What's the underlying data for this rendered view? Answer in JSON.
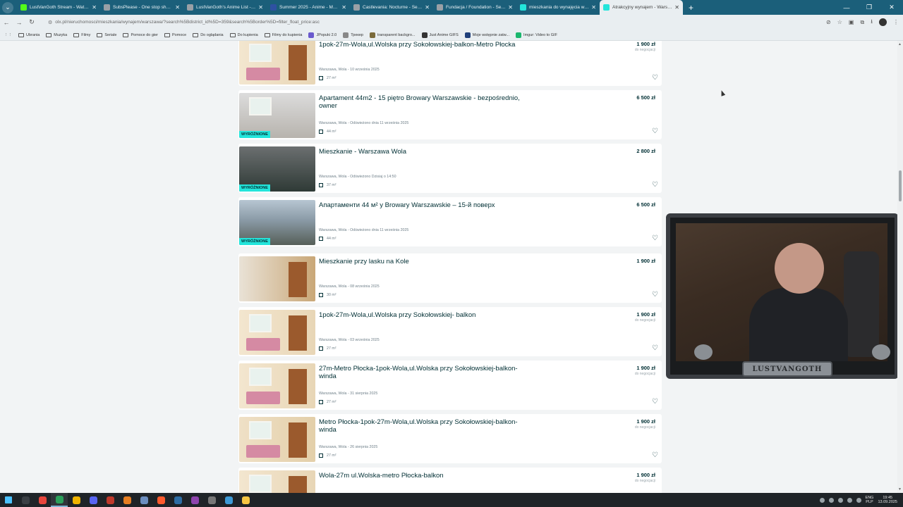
{
  "browser": {
    "tabs": [
      {
        "title": "LustVanGoth Stream - Watch Li",
        "color": "#53fc18"
      },
      {
        "title": "SubsPlease - One stop shop fo",
        "color": "#9aa0a6"
      },
      {
        "title": "LustVanGoth's Anime List - My",
        "color": "#9aa0a6"
      },
      {
        "title": "Summer 2025 - Anime - MyAni",
        "color": "#2e51a2"
      },
      {
        "title": "Castlevania: Nocturne - Sezon",
        "color": "#9aa0a6"
      },
      {
        "title": "Fundacja / Foundation - Sezon",
        "color": "#9aa0a6"
      },
      {
        "title": "mieszkania do wynajęcia warsz",
        "color": "#23e5db"
      },
      {
        "title": "Atrakcyjny wynajem - Warszaw",
        "color": "#23e5db",
        "active": true
      }
    ],
    "url": "olx.pl/nieruchomosci/mieszkania/wynajem/warszawa/?search%5Bdistrict_id%5D=359&search%5Border%5D=filter_float_price:asc",
    "bookmarks": [
      {
        "label": "Ubrania",
        "type": "folder"
      },
      {
        "label": "Muzyka",
        "type": "folder"
      },
      {
        "label": "Filmy",
        "type": "folder"
      },
      {
        "label": "Seriale",
        "type": "folder"
      },
      {
        "label": "Pomoce do gier",
        "type": "folder"
      },
      {
        "label": "Pomoce",
        "type": "folder"
      },
      {
        "label": "Do oglądania",
        "type": "folder"
      },
      {
        "label": "Do kupienia",
        "type": "folder"
      },
      {
        "label": "Filmy do kupienia",
        "type": "folder"
      },
      {
        "label": "JPopuki 2.0",
        "type": "site",
        "color": "#6a5acd"
      },
      {
        "label": "Трекер",
        "type": "site",
        "color": "#888"
      },
      {
        "label": "transparent backgro...",
        "type": "site",
        "color": "#7a6a3a"
      },
      {
        "label": "Just Anime GIFS",
        "type": "site",
        "color": "#333"
      },
      {
        "label": "Moje wstępnie zatw...",
        "type": "site",
        "color": "#1f3f7a"
      },
      {
        "label": "Imgur: Video to GIF",
        "type": "site",
        "color": "#1bb76e"
      }
    ]
  },
  "listings": [
    {
      "title": "1pok-27m-Wola,ul.Wolska przy Sokołowskiej-balkon-Metro Płocka",
      "location": "Warszawa, Wola - 10 września 2025",
      "area": "27 m²",
      "price": "1 900 zł",
      "negotiable": "do negocjacji",
      "featured": "",
      "photo": "room-pink"
    },
    {
      "title": "Apartament 44m2 - 15 piętro Browary Warszawskie - bezpośrednio, owner",
      "location": "Warszawa, Wola - Odświeżono dnia 11 września 2025",
      "area": "44 m²",
      "price": "6 500 zł",
      "negotiable": "",
      "featured": "WYRÓŻNIONE",
      "photo": "room-modern"
    },
    {
      "title": "Mieszkanie - Warszawa Wola",
      "location": "Warszawa, Wola - Odświeżono Dzisiaj o 14:50",
      "area": "37 m²",
      "price": "2 800 zł",
      "negotiable": "",
      "featured": "WYRÓŻNIONE",
      "photo": "room-dark"
    },
    {
      "title": "Апартаменти 44 м² у Browary Warszawskie – 15-й поверх",
      "location": "Warszawa, Wola - Odświeżono dnia 11 września 2025",
      "area": "44 m²",
      "price": "6 500 zł",
      "negotiable": "",
      "featured": "WYRÓŻNIONE",
      "photo": "city-view"
    },
    {
      "title": "Mieszkanie przy lasku na Kole",
      "location": "Warszawa, Wola - 08 września 2025",
      "area": "30 m²",
      "price": "1 900 zł",
      "negotiable": "",
      "featured": "",
      "photo": "room-wood"
    },
    {
      "title": "1pok-27m-Wola,ul.Wolska przy Sokołowskiej- balkon",
      "location": "Warszawa, Wola - 03 września 2025",
      "area": "27 m²",
      "price": "1 900 zł",
      "negotiable": "do negocjacji",
      "featured": "",
      "photo": "room-pink"
    },
    {
      "title": "27m-Metro Płocka-1pok-Wola,ul.Wolska przy Sokołowskiej-balkon-winda",
      "location": "Warszawa, Wola - 31 sierpnia 2025",
      "area": "27 m²",
      "price": "1 900 zł",
      "negotiable": "do negocjacji",
      "featured": "",
      "photo": "room-pink"
    },
    {
      "title": "Metro Płocka-1pok-27m-Wola,ul.Wolska przy Sokołowskiej-balkon-winda",
      "location": "Warszawa, Wola - 26 sierpnia 2025",
      "area": "27 m²",
      "price": "1 900 zł",
      "negotiable": "do negocjacji",
      "featured": "",
      "photo": "room-pink2"
    },
    {
      "title": "Wola-27m ul.Wolska-metro Płocka-balkon",
      "location": "",
      "area": "",
      "price": "1 900 zł",
      "negotiable": "do negocjacji",
      "featured": "",
      "photo": "room-pink"
    }
  ],
  "webcam": {
    "nameplate": "LUSTVANGOTH"
  },
  "taskbar": {
    "apps": [
      {
        "color": "#3a3f44"
      },
      {
        "color": "#e8453c"
      },
      {
        "color": "#2aa05a",
        "active": true
      },
      {
        "color": "#f0b400"
      },
      {
        "color": "#5865f2"
      },
      {
        "color": "#c0392b"
      },
      {
        "color": "#e67e22"
      },
      {
        "color": "#6c8ebf"
      },
      {
        "color": "#ff5a2d"
      },
      {
        "color": "#2e6da4"
      },
      {
        "color": "#8e44ad"
      },
      {
        "color": "#777777"
      },
      {
        "color": "#3d9ad6"
      },
      {
        "color": "#f5c542"
      }
    ],
    "lang_top": "ENG",
    "lang_bottom": "PLP",
    "time": "19:45",
    "date": "13.09.2025"
  }
}
